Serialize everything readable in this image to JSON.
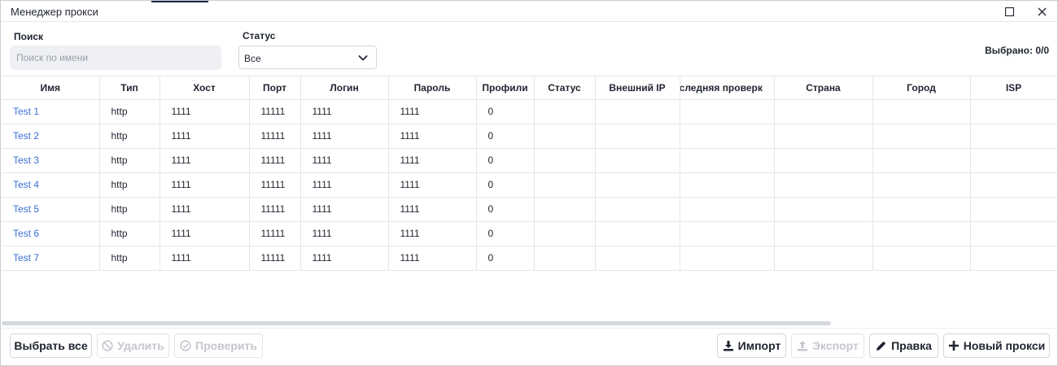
{
  "window": {
    "title": "Менеджер прокси"
  },
  "filters": {
    "search_label": "Поиск",
    "search_placeholder": "Поиск по имени",
    "search_value": "",
    "status_label": "Статус",
    "status_value": "Все",
    "selected_text": "Выбрано: 0/0"
  },
  "table": {
    "columns": [
      "Имя",
      "Тип",
      "Хост",
      "Порт",
      "Логин",
      "Пароль",
      "Профили",
      "Статус",
      "Внешний IP",
      "оследняя проверк",
      "Страна",
      "Город",
      "ISP"
    ],
    "rows": [
      {
        "name": "Test 1",
        "type": "http",
        "host": "1111",
        "port": "11111",
        "login": "1111",
        "password": "1111",
        "profiles": "0"
      },
      {
        "name": "Test 2",
        "type": "http",
        "host": "1111",
        "port": "11111",
        "login": "1111",
        "password": "1111",
        "profiles": "0"
      },
      {
        "name": "Test 3",
        "type": "http",
        "host": "1111",
        "port": "11111",
        "login": "1111",
        "password": "1111",
        "profiles": "0"
      },
      {
        "name": "Test 4",
        "type": "http",
        "host": "1111",
        "port": "11111",
        "login": "1111",
        "password": "1111",
        "profiles": "0"
      },
      {
        "name": "Test 5",
        "type": "http",
        "host": "1111",
        "port": "11111",
        "login": "1111",
        "password": "1111",
        "profiles": "0"
      },
      {
        "name": "Test 6",
        "type": "http",
        "host": "1111",
        "port": "11111",
        "login": "1111",
        "password": "1111",
        "profiles": "0"
      },
      {
        "name": "Test 7",
        "type": "http",
        "host": "1111",
        "port": "11111",
        "login": "1111",
        "password": "1111",
        "profiles": "0"
      }
    ]
  },
  "actions": {
    "select_all": "Выбрать все",
    "delete": "Удалить",
    "check": "Проверить",
    "import": "Импорт",
    "export": "Экспорт",
    "edit": "Правка",
    "new_proxy": "Новый прокси"
  },
  "icons": {
    "maximize": "maximize-icon",
    "close": "close-icon",
    "dropdown": "chevron-down-icon",
    "delete": "ban-icon",
    "check": "check-circle-icon",
    "import": "download-icon",
    "export": "upload-icon",
    "edit": "pencil-icon",
    "new": "plus-icon"
  },
  "colors": {
    "link": "#3b6fd4",
    "text": "#1f2430",
    "disabled": "#c4c7cd",
    "input_bg": "#eef0f4"
  }
}
